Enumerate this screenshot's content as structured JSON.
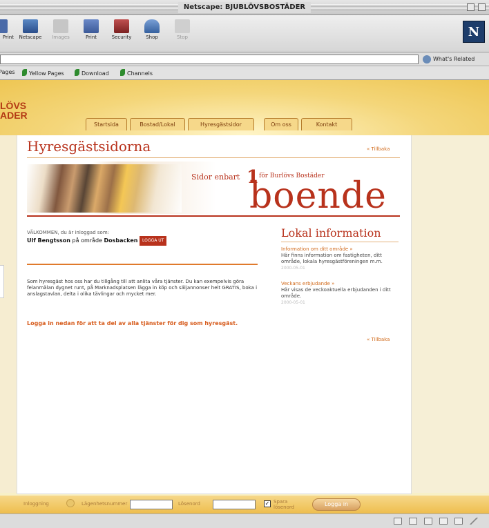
{
  "window": {
    "title": "Netscape: BJUBLÖVSBOSTÄDER"
  },
  "toolbar": {
    "buttons": [
      {
        "label": "Print",
        "icon": "print-icon"
      },
      {
        "label": "Netscape",
        "icon": "netscape-icon"
      },
      {
        "label": "Images",
        "icon": "images-icon"
      },
      {
        "label": "Print",
        "icon": "print-icon"
      },
      {
        "label": "Security",
        "icon": "security-icon"
      },
      {
        "label": "Shop",
        "icon": "shop-icon"
      },
      {
        "label": "Stop",
        "icon": "stop-icon"
      }
    ],
    "logo": "N"
  },
  "location": {
    "value": "",
    "related_label": "What's Related"
  },
  "personal_bar": {
    "items": [
      "Pages",
      "Yellow Pages",
      "Download",
      "Channels"
    ]
  },
  "site": {
    "brand_line1": "LÖVS",
    "brand_line2": "ADER",
    "nav": [
      "Startsida",
      "Bostad/Lokal",
      "Hyresgästsidor",
      "Om oss",
      "Kontakt"
    ],
    "heading": "Hyresgästsidorna",
    "back_link_top": "« Tillbaka",
    "banner": {
      "slogan": "Sidor enbart",
      "number": "1",
      "sub": "för Burlövs Bostäder",
      "word": "boende"
    },
    "welcome_line1": "VÄLKOMMEN, du är inloggad som:",
    "welcome_user": "Ulf Bengtsson",
    "welcome_mid": "på område",
    "welcome_area": "Dosbacken",
    "logout_label": "LOGGA UT",
    "paragraph": "Som hyresgäst hos oss har du tillgång till att anlita våra tjänster. Du kan exempelvis göra felanmälan dygnet runt, på Marknadsplatsen lägga in köp och säljannonser helt GRATIS, boka i anslagstavlan, delta i olika tävlingar och mycket mer.",
    "cta": "Logga in nedan för att ta del av alla tjänster för dig som hyresgäst.",
    "local_info": {
      "heading": "Lokal information",
      "items": [
        {
          "link": "Information om ditt område »",
          "text": "Här finns information om fastigheten, ditt område, lokala hyresgästföreningen m.m.",
          "date": "2000-05-01"
        },
        {
          "link": "Veckans erbjudande »",
          "text": "Här visas de veckoaktuella erbjudanden i ditt område.",
          "date": "2000-05-01"
        }
      ],
      "back_link": "« Tillbaka"
    }
  },
  "login": {
    "hint": "Inloggning",
    "user_label": "Lägenhetsnummer",
    "pass_label": "Lösenord",
    "remember_label": "Spara lösenord",
    "button": "Logga in"
  }
}
